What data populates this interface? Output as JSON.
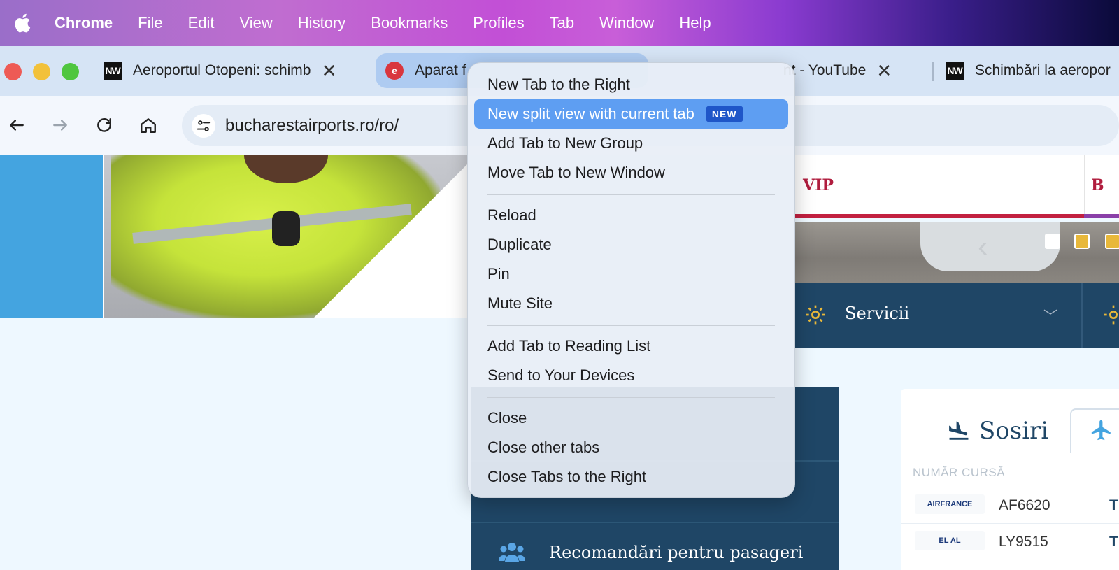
{
  "menubar": {
    "app": "Chrome",
    "items": [
      "File",
      "Edit",
      "View",
      "History",
      "Bookmarks",
      "Profiles",
      "Tab",
      "Window",
      "Help"
    ]
  },
  "tabs": [
    {
      "favicon": "NW",
      "title": "Aeroportul Otopeni: schimb",
      "close": "✕"
    },
    {
      "favicon": "e",
      "title": "Aparat f",
      "close": ""
    },
    {
      "favicon": "",
      "title": "nt - YouTube",
      "close": "✕"
    },
    {
      "favicon": "NW",
      "title": "Schimbări la aeropor",
      "close": ""
    }
  ],
  "toolbar": {
    "url": "bucharestairports.ro/ro/"
  },
  "page": {
    "vip": "VIP",
    "b_letter": "B",
    "services": "Servicii",
    "recommendations": "Recomandări pentru pasageri",
    "arrivals": "Sosiri",
    "flight_number_header": "NUMĂR CURSĂ",
    "flights": [
      {
        "airline": "AIRFRANCE",
        "code": "AF6620",
        "terminal": "T"
      },
      {
        "airline": "EL AL",
        "code": "LY9515",
        "terminal": "T"
      }
    ]
  },
  "context_menu": {
    "new_tab_right": "New Tab to the Right",
    "split_view": "New split view with current tab",
    "split_badge": "NEW",
    "add_group": "Add Tab to New Group",
    "move_window": "Move Tab to New Window",
    "reload": "Reload",
    "duplicate": "Duplicate",
    "pin": "Pin",
    "mute": "Mute Site",
    "reading_list": "Add Tab to Reading List",
    "send_devices": "Send to Your Devices",
    "close": "Close",
    "close_other": "Close other tabs",
    "close_right": "Close Tabs to the Right"
  },
  "colors": {
    "menu_highlight": "#5e9ef2",
    "badge": "#1f56c8",
    "site_navy": "#1f4666",
    "site_accent": "#e8b83a"
  }
}
